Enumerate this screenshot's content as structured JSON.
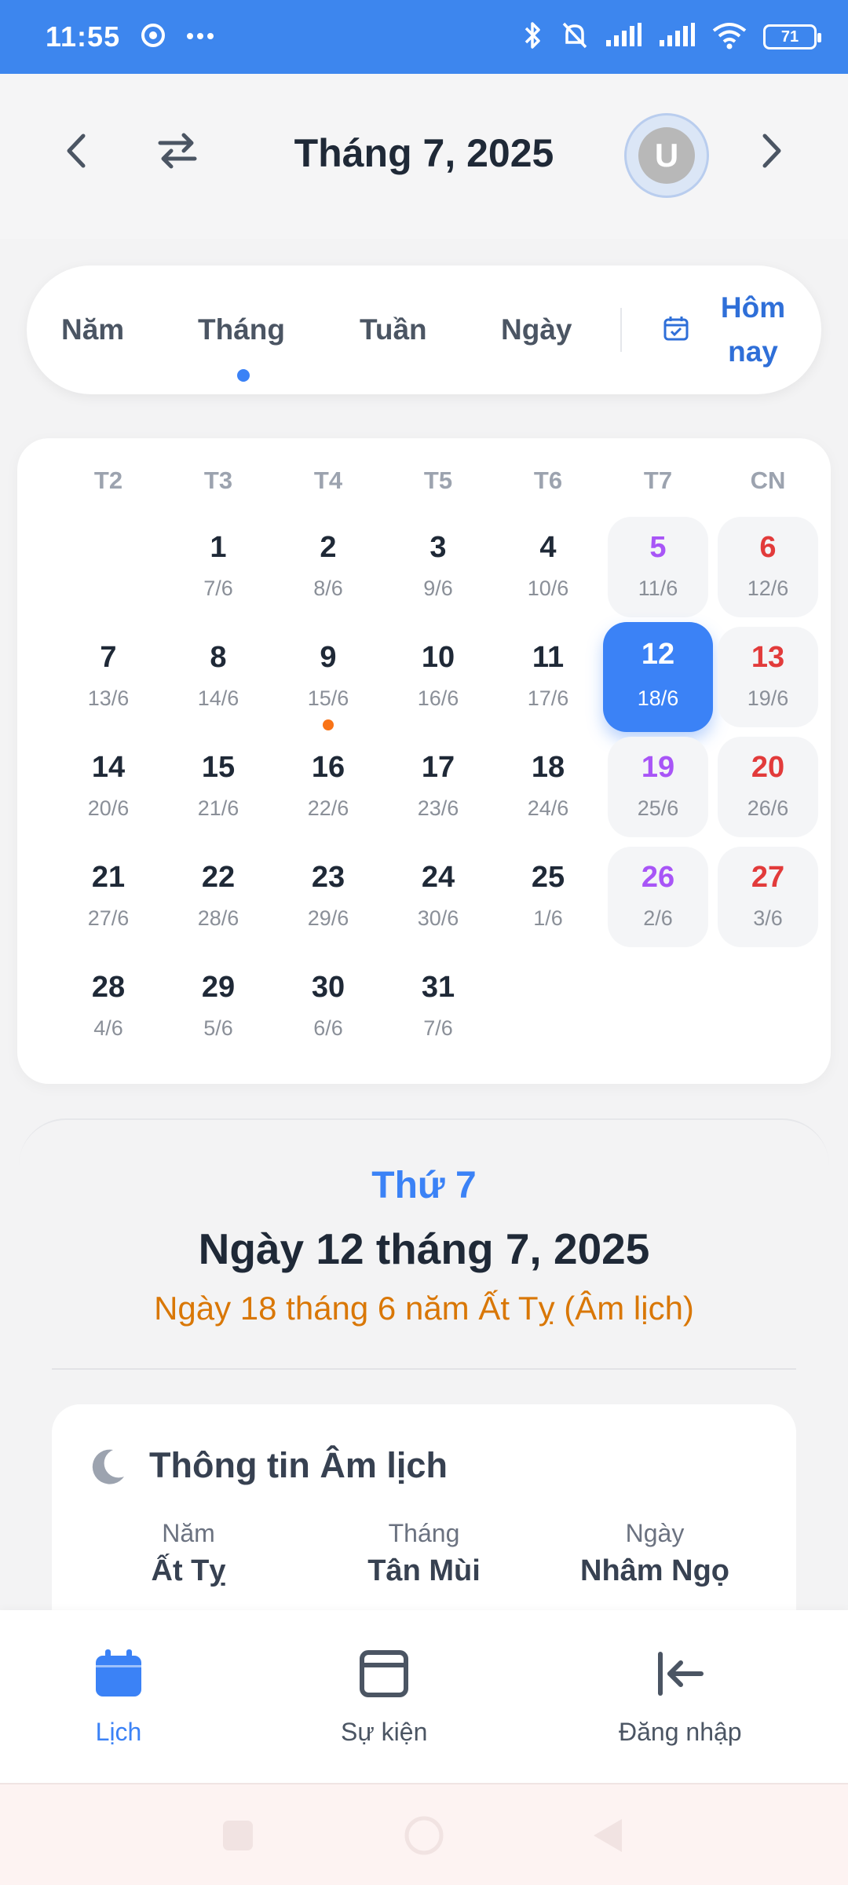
{
  "status_bar": {
    "time": "11:55",
    "battery": "71",
    "icons": [
      "chrome-icon",
      "more-icon",
      "bluetooth-icon",
      "bell-muted-icon",
      "signal-icon",
      "signal-icon",
      "wifi-icon",
      "battery-icon"
    ]
  },
  "header": {
    "title": "Tháng 7, 2025",
    "avatar_initial": "U",
    "icons": [
      "chevron-left-icon",
      "swap-icon",
      "chevron-right-icon"
    ]
  },
  "view_tabs": {
    "items": [
      {
        "label": "Năm"
      },
      {
        "label": "Tháng",
        "active": true
      },
      {
        "label": "Tuần"
      },
      {
        "label": "Ngày"
      }
    ],
    "today_label": "Hôm nay"
  },
  "calendar": {
    "weekdays": [
      "T2",
      "T3",
      "T4",
      "T5",
      "T6",
      "T7",
      "CN"
    ],
    "days": [
      {
        "d": "1",
        "l": "7/6"
      },
      {
        "d": "2",
        "l": "8/6"
      },
      {
        "d": "3",
        "l": "9/6"
      },
      {
        "d": "4",
        "l": "10/6"
      },
      {
        "d": "5",
        "l": "11/6"
      },
      {
        "d": "6",
        "l": "12/6"
      },
      {
        "d": "7",
        "l": "13/6"
      },
      {
        "d": "8",
        "l": "14/6"
      },
      {
        "d": "9",
        "l": "15/6",
        "event": true
      },
      {
        "d": "10",
        "l": "16/6"
      },
      {
        "d": "11",
        "l": "17/6"
      },
      {
        "d": "12",
        "l": "18/6",
        "selected": true
      },
      {
        "d": "13",
        "l": "19/6"
      },
      {
        "d": "14",
        "l": "20/6"
      },
      {
        "d": "15",
        "l": "21/6"
      },
      {
        "d": "16",
        "l": "22/6"
      },
      {
        "d": "17",
        "l": "23/6"
      },
      {
        "d": "18",
        "l": "24/6"
      },
      {
        "d": "19",
        "l": "25/6"
      },
      {
        "d": "20",
        "l": "26/6"
      },
      {
        "d": "21",
        "l": "27/6"
      },
      {
        "d": "22",
        "l": "28/6"
      },
      {
        "d": "23",
        "l": "29/6"
      },
      {
        "d": "24",
        "l": "30/6"
      },
      {
        "d": "25",
        "l": "1/6"
      },
      {
        "d": "26",
        "l": "2/6"
      },
      {
        "d": "27",
        "l": "3/6"
      },
      {
        "d": "28",
        "l": "4/6"
      },
      {
        "d": "29",
        "l": "5/6"
      },
      {
        "d": "30",
        "l": "6/6"
      },
      {
        "d": "31",
        "l": "7/6"
      }
    ]
  },
  "detail": {
    "weekday": "Thứ 7",
    "full_date": "Ngày 12 tháng 7, 2025",
    "lunar_date": "Ngày 18 tháng 6 năm Ất Tỵ (Âm lịch)",
    "info_title": "Thông tin Âm lịch",
    "info_items": [
      {
        "k": "Năm",
        "v": "Ất Tỵ"
      },
      {
        "k": "Tháng",
        "v": "Tân Mùi"
      },
      {
        "k": "Ngày",
        "v": "Nhâm Ngọ"
      }
    ]
  },
  "bottom_nav": {
    "items": [
      {
        "label": "Lịch",
        "icon": "calendar-icon",
        "active": true
      },
      {
        "label": "Sự kiện",
        "icon": "event-icon"
      },
      {
        "label": "Đăng nhập",
        "icon": "login-icon"
      }
    ]
  },
  "colors": {
    "primary": "#3b82f6",
    "saturday": "#a855f7",
    "sunday": "#e23b3b",
    "lunar": "#d97706",
    "event_dot": "#f97316"
  }
}
